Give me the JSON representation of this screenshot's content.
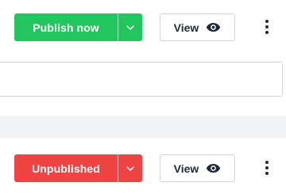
{
  "row1": {
    "primary_label": "Publish now",
    "view_label": "View"
  },
  "row2": {
    "primary_label": "Unpublished",
    "view_label": "View"
  },
  "icons": {
    "caret": "chevron-down-icon",
    "view": "eye-icon",
    "more": "more-vertical-icon"
  },
  "colors": {
    "publish": "#22c55e",
    "unpublished": "#ef4444"
  }
}
